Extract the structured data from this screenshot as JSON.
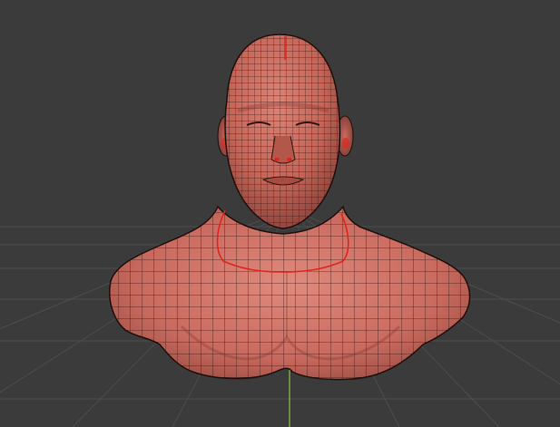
{
  "viewport": {
    "name": "3D Viewport",
    "background_color": "#3b3b3b",
    "grid_color": "#4d4d4d",
    "y_axis_color": "#8bc34a",
    "grid_visible": true
  },
  "object": {
    "type": "bust-sculpt-mesh",
    "display": "wireframe-on-shaded",
    "base_color": "#c96a5f",
    "shadow_color": "#7e3a33",
    "wire_color": "#2b1612",
    "seam_color": "#e0261b",
    "eyes": "closed"
  }
}
